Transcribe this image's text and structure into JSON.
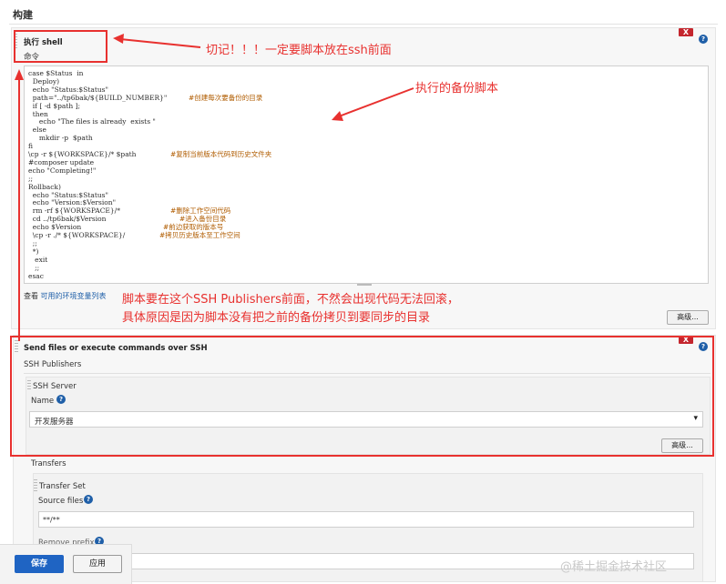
{
  "section": {
    "title": "构建"
  },
  "shell_step": {
    "title": "执行 shell",
    "command_label": "命令",
    "code_lines": [
      {
        "text": "case $Status  in",
        "comment": ""
      },
      {
        "text": "  Deploy)",
        "comment": ""
      },
      {
        "text": "  echo \"Status:$Status\"",
        "comment": ""
      },
      {
        "text": "  path=\"../tp6bak/${BUILD_NUMBER}\"",
        "comment": "#创建每次要备份的目录"
      },
      {
        "text": "  if [ -d $path ];",
        "comment": ""
      },
      {
        "text": "  then",
        "comment": ""
      },
      {
        "text": "     echo \"The files is already  exists \"",
        "comment": ""
      },
      {
        "text": "  else",
        "comment": ""
      },
      {
        "text": "     mkdir -p  $path",
        "comment": ""
      },
      {
        "text": "fi",
        "comment": ""
      },
      {
        "text": "\\cp -r ${WORKSPACE}/* $path",
        "comment": "#复制当前版本代码到历史文件夹"
      },
      {
        "text": "#composer update",
        "comment": ""
      },
      {
        "text": "echo \"Completing!\"",
        "comment": ""
      },
      {
        "text": ";;",
        "comment": ""
      },
      {
        "text": "Rollback)",
        "comment": ""
      },
      {
        "text": "  echo \"Status:$Status\"",
        "comment": ""
      },
      {
        "text": "  echo \"Version:$Version\"",
        "comment": ""
      },
      {
        "text": "  rm -rf ${WORKSPACE}/*",
        "comment": "#删除工作空间代码"
      },
      {
        "text": "  cd ../tp6bak/$Version",
        "comment": "#进入备份目录"
      },
      {
        "text": "  echo $Version",
        "comment": "#前边获取的版本号"
      },
      {
        "text": "  \\cp -r ./* ${WORKSPACE}/",
        "comment": "#拷贝历史版本至工作空间"
      },
      {
        "text": "  ;;",
        "comment": ""
      },
      {
        "text": "  *)",
        "comment": ""
      },
      {
        "text": "   exit",
        "comment": ""
      },
      {
        "text": "   ;;",
        "comment": ""
      },
      {
        "text": "esac",
        "comment": ""
      }
    ],
    "env_prefix": "查看",
    "env_link": "可用的环境变量列表",
    "advanced_label": "高级...",
    "delete_label": "X",
    "help_label": "?"
  },
  "annotations": {
    "top": "切记！！！一定要脚本放在ssh前面",
    "backup": "执行的备份脚本",
    "middle_line1": "脚本要在这个SSH Publishers前面，不然会出现代码无法回滚，",
    "middle_line2": "具体原因是因为脚本没有把之前的备份拷贝到要同步的目录",
    "color": "#e8312f"
  },
  "ssh_step": {
    "title": "Send files or execute commands over SSH",
    "publishers_label": "SSH Publishers",
    "server_label": "SSH Server",
    "name_label": "Name",
    "name_value": "开发服务器",
    "advanced_label": "高级...",
    "transfers_label": "Transfers",
    "transfer_set_label": "Transfer Set",
    "source_files_label": "Source files",
    "source_files_value": "**/**",
    "remove_prefix_label": "Remove prefix",
    "delete_label": "X",
    "help_label": "?"
  },
  "bottom": {
    "save_label": "保存",
    "apply_label": "应用"
  },
  "watermark": "@稀土掘金技术社区",
  "colors": {
    "primary": "#1f64c3",
    "link": "#1f5fa8",
    "danger": "#c4262e"
  }
}
